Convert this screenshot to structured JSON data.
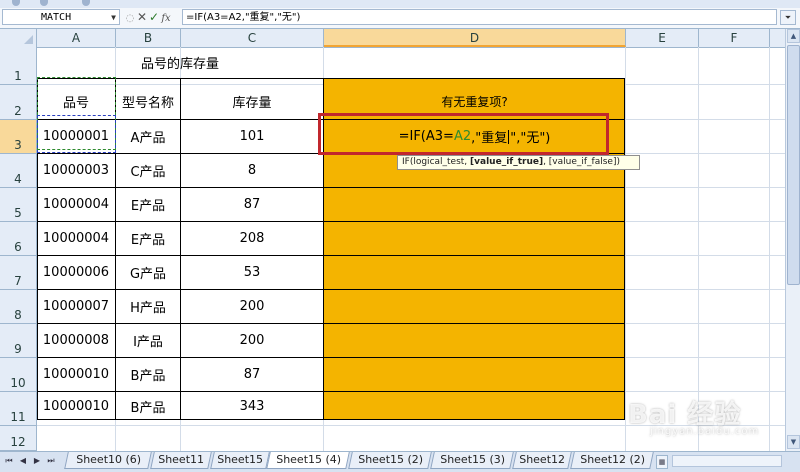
{
  "name_box": {
    "value": "MATCH"
  },
  "formula_bar": {
    "buttons": [
      "✕",
      "✓",
      "fx"
    ],
    "value": "=IF(A3=A2,\"重复\",\"无\")"
  },
  "columns": [
    "A",
    "B",
    "C",
    "D",
    "E",
    "F"
  ],
  "rows": [
    "1",
    "2",
    "3",
    "4",
    "5",
    "6",
    "7",
    "8",
    "9",
    "10",
    "11",
    "12"
  ],
  "sheet": {
    "title": "品号的库存量",
    "headers": [
      "品号",
      "型号名称",
      "库存量",
      "有无重复项?"
    ],
    "data": [
      [
        "10000001",
        "A产品",
        "101"
      ],
      [
        "10000003",
        "C产品",
        "8"
      ],
      [
        "10000004",
        "E产品",
        "87"
      ],
      [
        "10000004",
        "E产品",
        "208"
      ],
      [
        "10000006",
        "G产品",
        "53"
      ],
      [
        "10000007",
        "H产品",
        "200"
      ],
      [
        "10000008",
        "I产品",
        "200"
      ],
      [
        "10000010",
        "B产品",
        "87"
      ],
      [
        "10000010",
        "B产品",
        "343"
      ]
    ],
    "edit_cell": {
      "prefix": "=IF(A3=",
      "ref": "A2",
      "mid": ",\"重复",
      "suffix": "\",\"无\")"
    }
  },
  "tooltip": {
    "prefix": "IF(logical_test, ",
    "bold": "[value_if_true]",
    "suffix": ", [value_if_false])"
  },
  "sheet_tabs": [
    "Sheet10 (6)",
    "Sheet11",
    "Sheet15",
    "Sheet15 (4)",
    "Sheet15 (2)",
    "Sheet15 (3)",
    "Sheet12",
    "Sheet12 (2)"
  ],
  "active_tab": "Sheet15 (4)",
  "watermark": {
    "main": "Bai 经验",
    "sub": "jingyan.baidu.com"
  },
  "colors": {
    "highlight": "#f4b400",
    "red_box": "#c1272d",
    "ref_color": "#2e8b2e"
  }
}
